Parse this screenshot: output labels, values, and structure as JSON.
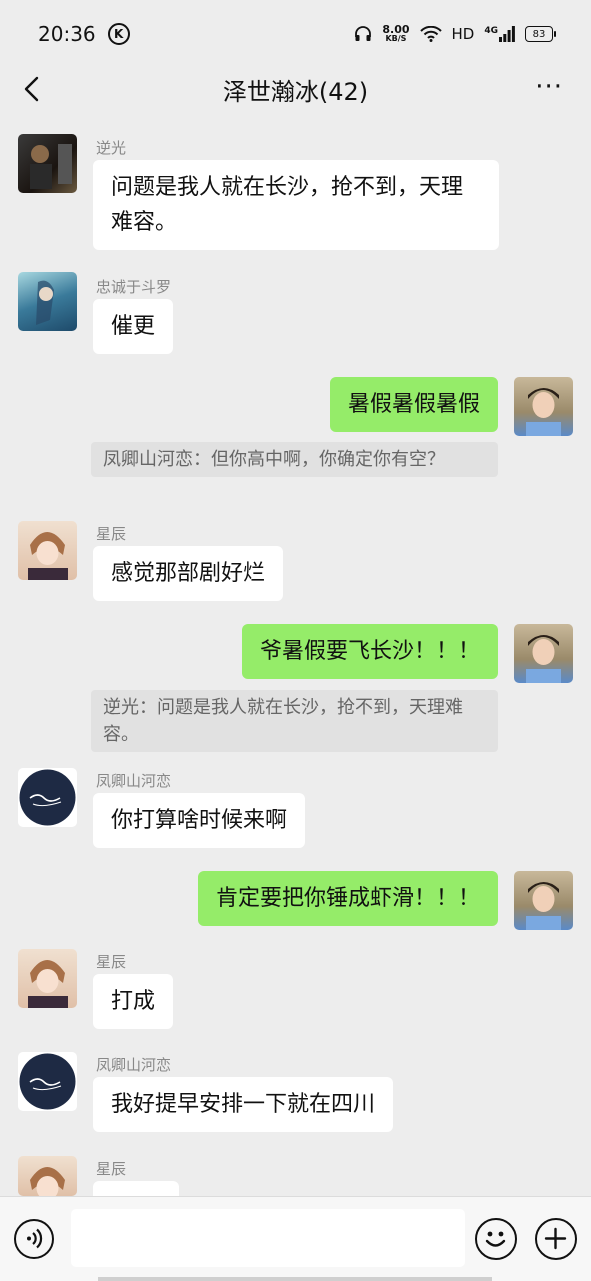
{
  "status_bar": {
    "time": "20:36",
    "k_label": "K",
    "net_speed": "8.00",
    "net_unit": "KB/S",
    "hd": "HD",
    "signal": "4G",
    "battery": "83"
  },
  "header": {
    "title": "泽世瀚冰(42)",
    "more_label": "···"
  },
  "messages": [
    {
      "sender": "逆光",
      "text": "问题是我人就在长沙，抢不到，天理难容。",
      "mine": false
    },
    {
      "sender": "忠诚于斗罗",
      "text": "催更",
      "mine": false
    },
    {
      "sender": "",
      "text": "暑假暑假暑假",
      "mine": true,
      "quote": "凤卿山河恋：但你高中啊，你确定你有空？"
    },
    {
      "sender": "星辰",
      "text": "感觉那部剧好烂",
      "mine": false
    },
    {
      "sender": "",
      "text": "爷暑假要飞长沙！！！",
      "mine": true,
      "quote": "逆光：问题是我人就在长沙，抢不到，天理难容。"
    },
    {
      "sender": "凤卿山河恋",
      "text": "你打算啥时候来啊",
      "mine": false
    },
    {
      "sender": "",
      "text": "肯定要把你锤成虾滑！！！",
      "mine": true
    },
    {
      "sender": "星辰",
      "text": "打成",
      "mine": false
    },
    {
      "sender": "凤卿山河恋",
      "text": "我好提早安排一下就在四川",
      "mine": false
    },
    {
      "sender": "星辰",
      "text": "",
      "mine": false
    }
  ],
  "input": {
    "placeholder": ""
  },
  "colors": {
    "bubble_mine": "#95ec69",
    "bubble_other": "#ffffff",
    "background": "#ededed"
  }
}
